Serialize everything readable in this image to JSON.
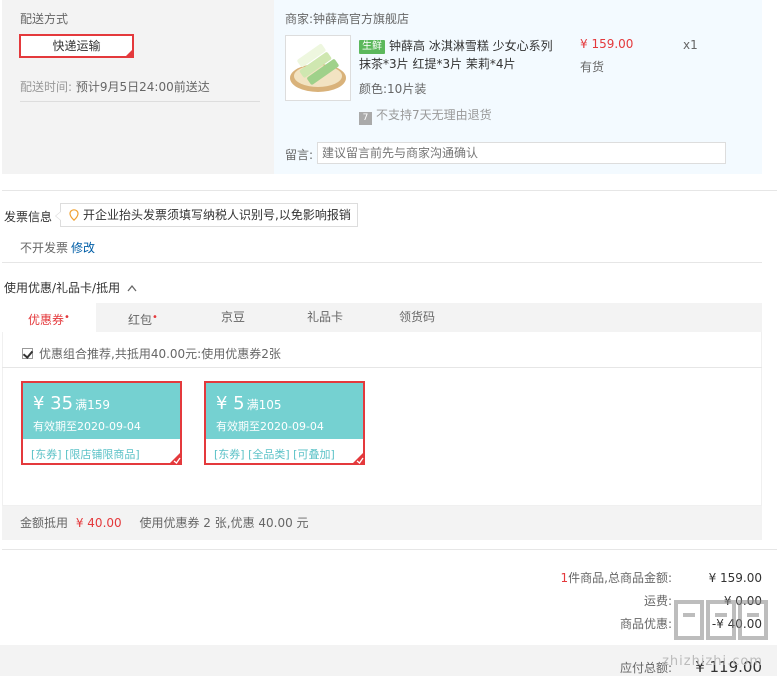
{
  "shipping": {
    "title": "配送方式",
    "method": "快递运输",
    "time_label": "配送时间:",
    "time_value": "预计9月5日24:00前送达"
  },
  "order": {
    "merchant": "商家:钟薛高官方旗舰店",
    "product": {
      "badge": "生鲜",
      "title": "钟薛高 冰淇淋雪糕 少女心系列 抹茶*3片 红提*3片 茉莉*4片",
      "price": "¥ 159.00",
      "qty": "x1",
      "stock": "有货",
      "color": "颜色:10片装",
      "return_policy": "不支持7天无理由退货"
    },
    "message_label": "留言:",
    "message_placeholder": "建议留言前先与商家沟通确认"
  },
  "invoice": {
    "title": "发票信息",
    "tip": "开企业抬头发票须填写纳税人识别号,以免影响报销",
    "value": "不开发票",
    "edit": "修改"
  },
  "coupons": {
    "title": "使用优惠/礼品卡/抵用",
    "tabs": [
      {
        "label": "优惠券",
        "dot": "•"
      },
      {
        "label": "红包",
        "dot": "•"
      },
      {
        "label": "京豆",
        "dot": ""
      },
      {
        "label": "礼品卡",
        "dot": ""
      },
      {
        "label": "领货码",
        "dot": ""
      }
    ],
    "recommend": "优惠组合推荐,共抵用40.00元:使用优惠券2张",
    "items": [
      {
        "amount": "¥ 35",
        "condition": "满159",
        "expiry": "有效期至2020-09-04",
        "tags": "[东券] [限店铺限商品]"
      },
      {
        "amount": "¥ 5",
        "condition": "满105",
        "expiry": "有效期至2020-09-04",
        "tags": "[东券] [全品类] [可叠加]"
      }
    ],
    "discount_label": "金额抵用",
    "discount_value": "¥ 40.00",
    "discount_summary": "使用优惠券 2 张,优惠 40.00 元"
  },
  "totals": {
    "count": "1",
    "count_suffix": "件商品,总商品金额:",
    "goods_total": "¥ 159.00",
    "shipping_label": "运费:",
    "shipping_value": "¥ 0.00",
    "discount_label": "商品优惠:",
    "discount_value": "-¥ 40.00",
    "payable_label": "应付总额:",
    "payable_value": "¥ 119.00"
  },
  "watermark": {
    "text": "zhizhizhi.com"
  },
  "colors": {
    "accent": "#e4393c",
    "coupon": "#75d1d1",
    "link": "#005ea7",
    "fresh": "#5cb85c"
  }
}
